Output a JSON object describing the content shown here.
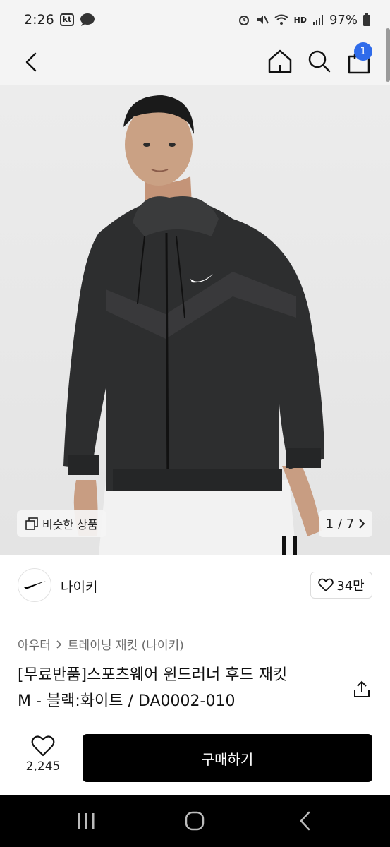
{
  "status": {
    "time": "2:26",
    "carrier": "kt",
    "voice": "HD",
    "battery": "97%"
  },
  "header": {
    "cart_count": "1"
  },
  "gallery": {
    "similar_label": "비슷한 상품",
    "pager": "1 / 7"
  },
  "brand": {
    "name": "나이키",
    "like_count": "34만"
  },
  "product": {
    "breadcrumb": [
      "아우터",
      "트레이닝 재킷 (나이키)"
    ],
    "title_line1": "[무료반품]스포츠웨어 윈드러너 후드 재킷",
    "title_line2": "M - 블랙:화이트 / DA0002-010"
  },
  "actions": {
    "wish_count": "2,245",
    "buy_label": "구매하기"
  },
  "colors": {
    "badge": "#2f6bea",
    "buy_bg": "#000000"
  }
}
